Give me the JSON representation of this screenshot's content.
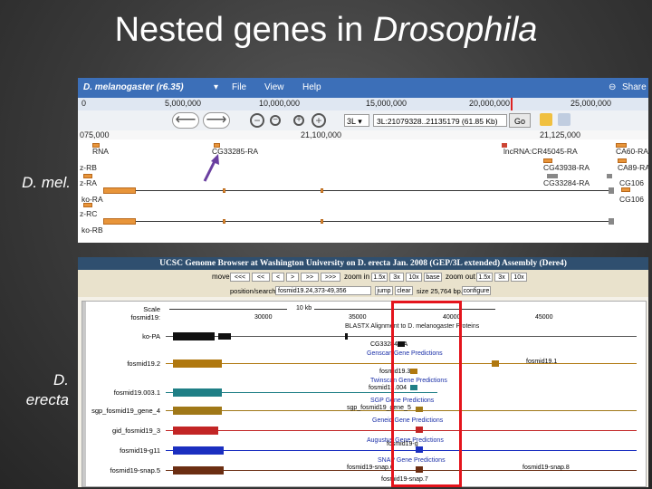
{
  "slide": {
    "title_plain": "Nested genes in ",
    "title_italic": "Drosophila",
    "label_dmel": "D. mel.",
    "label_erecta_1": "D.",
    "label_erecta_2": "erecta"
  },
  "jbrowse": {
    "dataset": "D. melanogaster (r6.35)",
    "menu": [
      "File",
      "View",
      "Help"
    ],
    "share_label": "Share",
    "overview_ticks": [
      "0",
      "5,000,000",
      "10,000,000",
      "15,000,000",
      "20,000,000",
      "25,000,000"
    ],
    "chrom": "3L",
    "location": "3L:21079328..21135179 (61.85 Kb)",
    "go_label": "Go",
    "ruler_ticks": [
      "075,000",
      "21,100,000",
      "21,125,000"
    ],
    "features": {
      "rna_left": "RNA",
      "cg33285": "CG33285-RA",
      "lncrna": "lncRNA:CR45045-RA",
      "ca60_ra": "CA60-RA",
      "z_rb": "z-RB",
      "cg43938": "CG43938-RA",
      "ca89_ra": "CA89-RA",
      "z_ra": "z-RA",
      "cg33284": "CG33284-RA",
      "cg10_a": "CG106",
      "ko_ra": "ko-RA",
      "cg10_b": "CG106",
      "z_rc": "z-RC",
      "ko_rb": "ko-RB"
    },
    "colors": {
      "menubar": "#3c6fb8",
      "exon": "#e8953a",
      "arrow": "#6a3fa0"
    }
  },
  "ucsc": {
    "title": "UCSC Genome Browser at Washington University on D. erecta Jan. 2008 (GEP/3L extended) Assembly (Dere4)",
    "move_label": "move",
    "move_buttons": [
      "<<<",
      "<<",
      "<",
      ">",
      ">>",
      ">>>"
    ],
    "zoom_in_label": "zoom in",
    "zoom_in_buttons": [
      "1.5x",
      "3x",
      "10x",
      "base"
    ],
    "zoom_out_label": "zoom out",
    "zoom_out_buttons": [
      "1.5x",
      "3x",
      "10x"
    ],
    "position_label": "position/search",
    "position_value": "fosmid19.24,373-49,356",
    "jump_label": "jump",
    "clear_label": "clear",
    "size_text": "size 25,764 bp.",
    "configure_label": "configure",
    "scale_label": "Scale",
    "scale_value": "10 kb",
    "chrom_label": "fosmid19:",
    "axis_ticks": [
      "30000",
      "35000",
      "40000",
      "45000"
    ],
    "blastx_label": "BLASTX Alignment to D. melanogaster Proteins",
    "blastx_feature": "CG33284-PA",
    "genscan_label": "Genscan Gene Predictions",
    "genscan_feature": "fosmid19.3",
    "twinscan_label": "Twinscan Gene Predictions",
    "twinscan_feature": "fosmid19.004",
    "sgp_label": "SGP Gene Predictions",
    "sgp_feature": "sgp_fosmid19_gene_5",
    "geneid_label": "Geneid Gene Predictions",
    "augustus_label": "Augustus Gene Predictions",
    "augustus_feature": "fosmid19-g",
    "snap_label": "SNAP Gene Predictions",
    "snap_feature": "fosmid19-snap.6",
    "snap_feature_2": "fosmid19-snap.7",
    "tracks": [
      {
        "name": "ko-PA",
        "color": "#111111"
      },
      {
        "name": "fosmid19.2",
        "color": "#b0780f"
      },
      {
        "name": "fosmid19.003.1",
        "color": "#1f7f86"
      },
      {
        "name": "sgp_fosmid19_gene_4",
        "color": "#a07818"
      },
      {
        "name": "gid_fosmid19_3",
        "color": "#c22525"
      },
      {
        "name": "fosmid19-g11",
        "color": "#1b2fc0"
      },
      {
        "name": "fosmid19-snap.5",
        "color": "#6b2e12"
      }
    ],
    "right_labels": {
      "genscan": "fosmid19.1",
      "snap": "fosmid19-snap.8"
    },
    "highlight_color": "#e4141c"
  }
}
